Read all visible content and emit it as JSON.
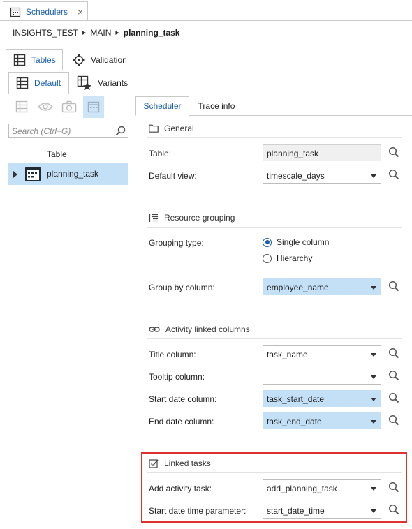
{
  "doc_tab": {
    "title": "Schedulers",
    "close": "×"
  },
  "breadcrumb": {
    "p1": "INSIGHTS_TEST",
    "p2": "MAIN",
    "p3": "planning_task"
  },
  "tabs1": {
    "tables": "Tables",
    "validation": "Validation"
  },
  "tabs2": {
    "default": "Default",
    "variants": "Variants"
  },
  "search": {
    "placeholder": "Search (Ctrl+G)"
  },
  "tree": {
    "column_header": "Table",
    "item": "planning_task"
  },
  "right_tabs": {
    "scheduler": "Scheduler",
    "trace": "Trace info"
  },
  "general": {
    "title": "General",
    "table_label": "Table:",
    "table_value": "planning_task",
    "view_label": "Default view:",
    "view_value": "timescale_days"
  },
  "grouping": {
    "title": "Resource grouping",
    "type_label": "Grouping type:",
    "opt_single": "Single column",
    "opt_hierarchy": "Hierarchy",
    "selected": "Single column",
    "col_label": "Group by column:",
    "col_value": "employee_name"
  },
  "activity": {
    "title": "Activity linked columns",
    "title_label": "Title column:",
    "title_value": "task_name",
    "tooltip_label": "Tooltip column:",
    "tooltip_value": "",
    "start_label": "Start date column:",
    "start_value": "task_start_date",
    "end_label": "End date column:",
    "end_value": "task_end_date"
  },
  "linked": {
    "title": "Linked tasks",
    "add_label": "Add activity task:",
    "add_value": "add_planning_task",
    "param_label": "Start date time parameter:",
    "param_value": "start_date_time"
  },
  "colors": {
    "accent": "#1b5fa8",
    "selection": "#c4e0f7",
    "highlight_border": "#e03131"
  }
}
